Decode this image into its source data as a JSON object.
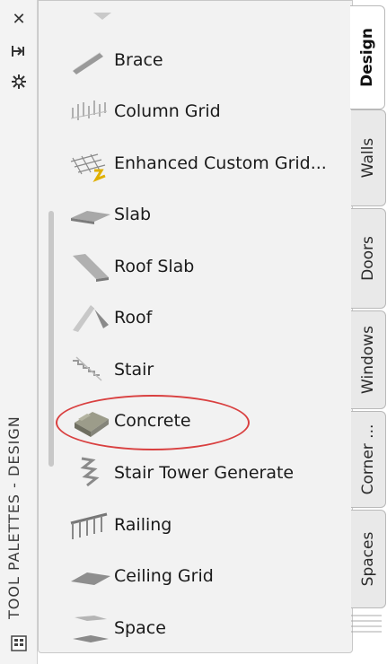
{
  "palette_title": "TOOL PALETTES - DESIGN",
  "strip_buttons": [
    {
      "name": "close-icon",
      "glyph": "✕"
    },
    {
      "name": "autohide-icon",
      "glyph": "⊣"
    },
    {
      "name": "gear-icon",
      "glyph": "✲"
    }
  ],
  "tools": [
    {
      "label": "Brace",
      "icon": "brace-icon"
    },
    {
      "label": "Column Grid",
      "icon": "column-grid-icon"
    },
    {
      "label": "Enhanced Custom Grid...",
      "icon": "enhanced-custom-grid-icon"
    },
    {
      "label": "Slab",
      "icon": "slab-icon"
    },
    {
      "label": "Roof Slab",
      "icon": "roof-slab-icon"
    },
    {
      "label": "Roof",
      "icon": "roof-icon"
    },
    {
      "label": "Stair",
      "icon": "stair-icon"
    },
    {
      "label": "Concrete",
      "icon": "concrete-icon"
    },
    {
      "label": "Stair Tower Generate",
      "icon": "stair-tower-icon"
    },
    {
      "label": "Railing",
      "icon": "railing-icon"
    },
    {
      "label": "Ceiling Grid",
      "icon": "ceiling-grid-icon"
    },
    {
      "label": "Space",
      "icon": "space-icon"
    }
  ],
  "tabs": [
    {
      "label": "Design",
      "active": true
    },
    {
      "label": "Walls",
      "active": false
    },
    {
      "label": "Doors",
      "active": false
    },
    {
      "label": "Windows",
      "active": false
    },
    {
      "label": "Corner ...",
      "active": false
    },
    {
      "label": "Spaces",
      "active": false
    }
  ],
  "highlighted_tool": "Concrete",
  "colors": {
    "highlight": "#d94040",
    "palette_bg": "#f2f2f2",
    "active_tab": "#ffffff"
  }
}
